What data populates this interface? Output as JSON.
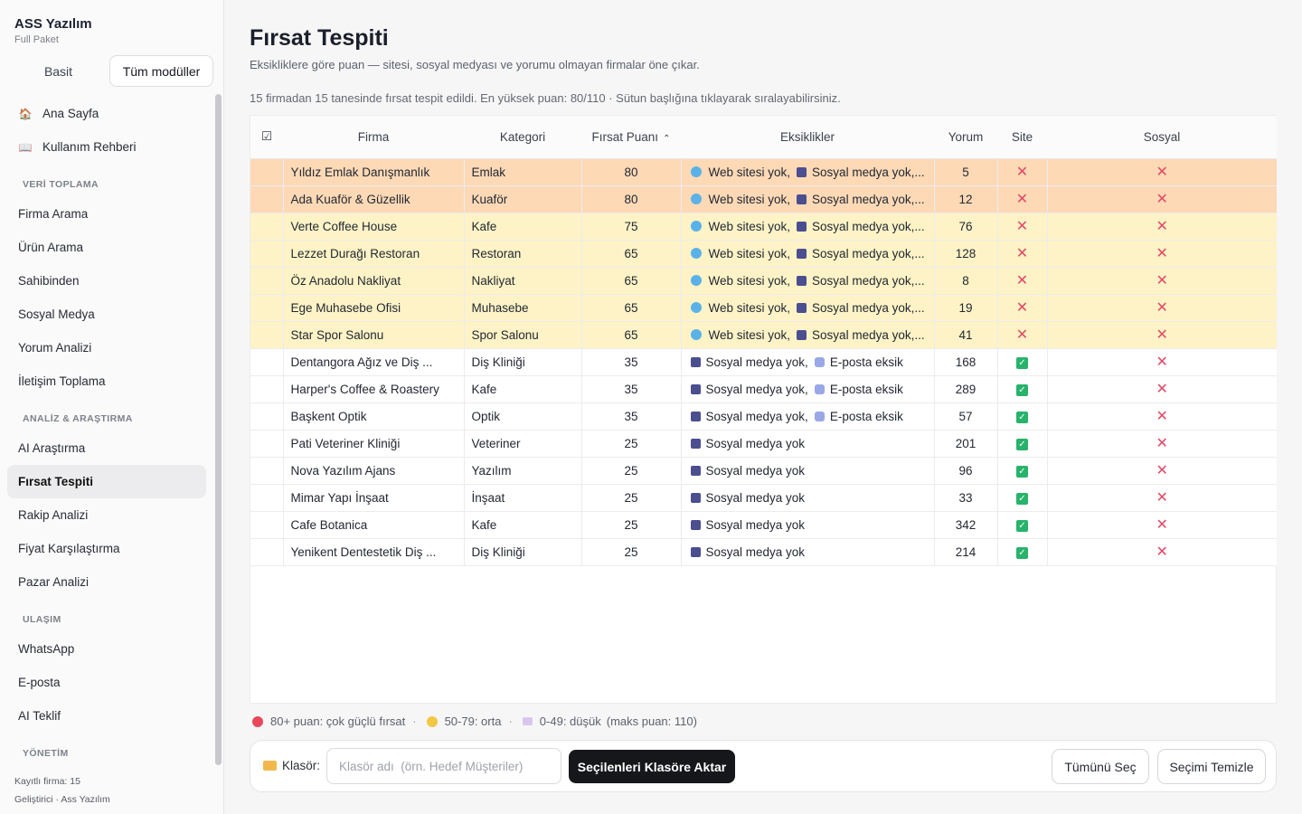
{
  "brand": {
    "title": "ASS Yazılım",
    "subtitle": "Full Paket"
  },
  "mode_switch": {
    "basic": "Basit",
    "all": "Tüm modüller"
  },
  "sidebar": {
    "top_items": [
      {
        "label": "Ana Sayfa",
        "icon": "house-icon"
      },
      {
        "label": "Kullanım Rehberi",
        "icon": "book-icon"
      }
    ],
    "sections": [
      {
        "title": "VERİ TOPLAMA",
        "items": [
          "Firma Arama",
          "Ürün Arama",
          "Sahibinden",
          "Sosyal Medya",
          "Yorum Analizi",
          "İletişim Toplama"
        ]
      },
      {
        "title": "ANALİZ & ARAŞTIRMA",
        "items": [
          "AI Araştırma",
          "Fırsat Tespiti",
          "Rakip Analizi",
          "Fiyat Karşılaştırma",
          "Pazar Analizi"
        ]
      },
      {
        "title": "ULAŞIM",
        "items": [
          "WhatsApp",
          "E-posta",
          "AI Teklif"
        ]
      },
      {
        "title": "YÖNETİM",
        "items": []
      }
    ],
    "active_item": "Fırsat Tespiti",
    "footer": {
      "count": "Kayıtlı firma: 15",
      "dev": "Geliştirici · Ass Yazılım"
    }
  },
  "page": {
    "title": "Fırsat Tespiti",
    "description": "Eksikliklere göre puan — sitesi, sosyal medyası ve yorumu olmayan firmalar öne çıkar.",
    "summary": "15 firmadan 15 tanesinde fırsat tespit edildi.  En yüksek puan: 80/110  ·  Sütun başlığına tıklayarak sıralayabilirsiniz."
  },
  "table": {
    "headers": {
      "select": "☑",
      "firma": "Firma",
      "kategori": "Kategori",
      "puan": "Fırsat Puanı",
      "eksik": "Eksiklikler",
      "yorum": "Yorum",
      "site": "Site",
      "sosyal": "Sosyal"
    },
    "sort_indicator": "^",
    "rows": [
      {
        "firma": "Yıldız Emlak Danışmanlık",
        "kategori": "Emlak",
        "puan": "80",
        "eksik": [
          "Web sitesi yok,",
          "Sosyal medya yok,..."
        ],
        "icons": [
          "globe-icon",
          "building-icon"
        ],
        "yorum": "5",
        "site": false,
        "sosyal": false,
        "tier": "hot"
      },
      {
        "firma": "Ada Kuaför & Güzellik",
        "kategori": "Kuaför",
        "puan": "80",
        "eksik": [
          "Web sitesi yok,",
          "Sosyal medya yok,..."
        ],
        "icons": [
          "globe-icon",
          "building-icon"
        ],
        "yorum": "12",
        "site": false,
        "sosyal": false,
        "tier": "hot"
      },
      {
        "firma": "Verte Coffee House",
        "kategori": "Kafe",
        "puan": "75",
        "eksik": [
          "Web sitesi yok,",
          "Sosyal medya yok,..."
        ],
        "icons": [
          "globe-icon",
          "building-icon"
        ],
        "yorum": "76",
        "site": false,
        "sosyal": false,
        "tier": "mid"
      },
      {
        "firma": "Lezzet Durağı Restoran",
        "kategori": "Restoran",
        "puan": "65",
        "eksik": [
          "Web sitesi yok,",
          "Sosyal medya yok,..."
        ],
        "icons": [
          "globe-icon",
          "building-icon"
        ],
        "yorum": "128",
        "site": false,
        "sosyal": false,
        "tier": "mid"
      },
      {
        "firma": "Öz Anadolu Nakliyat",
        "kategori": "Nakliyat",
        "puan": "65",
        "eksik": [
          "Web sitesi yok,",
          "Sosyal medya yok,..."
        ],
        "icons": [
          "globe-icon",
          "building-icon"
        ],
        "yorum": "8",
        "site": false,
        "sosyal": false,
        "tier": "mid"
      },
      {
        "firma": "Ege Muhasebe Ofisi",
        "kategori": "Muhasebe",
        "puan": "65",
        "eksik": [
          "Web sitesi yok,",
          "Sosyal medya yok,..."
        ],
        "icons": [
          "globe-icon",
          "building-icon"
        ],
        "yorum": "19",
        "site": false,
        "sosyal": false,
        "tier": "mid"
      },
      {
        "firma": "Star Spor Salonu",
        "kategori": "Spor Salonu",
        "puan": "65",
        "eksik": [
          "Web sitesi yok,",
          "Sosyal medya yok,..."
        ],
        "icons": [
          "globe-icon",
          "building-icon"
        ],
        "yorum": "41",
        "site": false,
        "sosyal": false,
        "tier": "mid"
      },
      {
        "firma": "Dentangora Ağız ve Diş ...",
        "kategori": "Diş Kliniği",
        "puan": "35",
        "eksik": [
          "Sosyal medya yok,",
          "E-posta eksik"
        ],
        "icons": [
          "building-icon",
          "mail-icon"
        ],
        "yorum": "168",
        "site": true,
        "sosyal": false,
        "tier": "low"
      },
      {
        "firma": "Harper's Coffee & Roastery",
        "kategori": "Kafe",
        "puan": "35",
        "eksik": [
          "Sosyal medya yok,",
          "E-posta eksik"
        ],
        "icons": [
          "building-icon",
          "mail-icon"
        ],
        "yorum": "289",
        "site": true,
        "sosyal": false,
        "tier": "low"
      },
      {
        "firma": "Başkent Optik",
        "kategori": "Optik",
        "puan": "35",
        "eksik": [
          "Sosyal medya yok,",
          "E-posta eksik"
        ],
        "icons": [
          "building-icon",
          "mail-icon"
        ],
        "yorum": "57",
        "site": true,
        "sosyal": false,
        "tier": "low"
      },
      {
        "firma": "Pati Veteriner Kliniği",
        "kategori": "Veteriner",
        "puan": "25",
        "eksik": [
          "Sosyal medya yok"
        ],
        "icons": [
          "building-icon"
        ],
        "yorum": "201",
        "site": true,
        "sosyal": false,
        "tier": "low"
      },
      {
        "firma": "Nova Yazılım Ajans",
        "kategori": "Yazılım",
        "puan": "25",
        "eksik": [
          "Sosyal medya yok"
        ],
        "icons": [
          "building-icon"
        ],
        "yorum": "96",
        "site": true,
        "sosyal": false,
        "tier": "low"
      },
      {
        "firma": "Mimar Yapı İnşaat",
        "kategori": "İnşaat",
        "puan": "25",
        "eksik": [
          "Sosyal medya yok"
        ],
        "icons": [
          "building-icon"
        ],
        "yorum": "33",
        "site": true,
        "sosyal": false,
        "tier": "low"
      },
      {
        "firma": "Cafe Botanica",
        "kategori": "Kafe",
        "puan": "25",
        "eksik": [
          "Sosyal medya yok"
        ],
        "icons": [
          "building-icon"
        ],
        "yorum": "342",
        "site": true,
        "sosyal": false,
        "tier": "low"
      },
      {
        "firma": "Yenikent Dentestetik Diş ...",
        "kategori": "Diş Kliniği",
        "puan": "25",
        "eksik": [
          "Sosyal medya yok"
        ],
        "icons": [
          "building-icon"
        ],
        "yorum": "214",
        "site": true,
        "sosyal": false,
        "tier": "low"
      }
    ]
  },
  "legend": {
    "high": "80+ puan: çok güçlü fırsat",
    "mid": "50-79: orta",
    "low": "0-49: düşük",
    "max": "(maks puan: 110)",
    "colors": {
      "high": "#e8495a",
      "mid": "#f2c744",
      "low": "#d9c6ef"
    }
  },
  "actions": {
    "folder_label": "Klasör:",
    "folder_placeholder": "Klasör adı  (örn. Hedef Müşteriler)",
    "export_button": "Seçilenleri Klasöre Aktar",
    "select_all": "Tümünü Seç",
    "clear_selection": "Seçimi Temizle"
  },
  "colors": {
    "hot_row": "#fdd9b6",
    "mid_row": "#fdf3c6",
    "primary_button": "#16171b",
    "x_mark": "#e34866",
    "check": "#27b36b"
  }
}
